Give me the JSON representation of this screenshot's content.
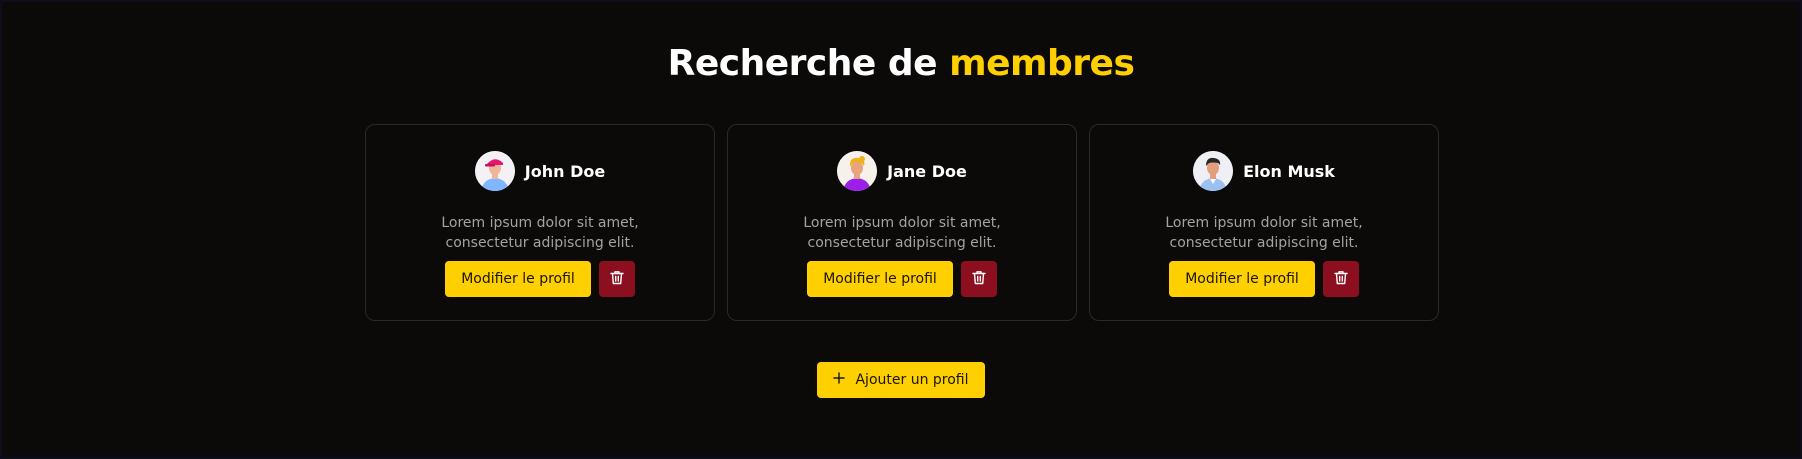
{
  "header": {
    "title_prefix": "Recherche de",
    "title_accent": "membres"
  },
  "colors": {
    "background": "#0b0a09",
    "accent": "#ffd000",
    "danger": "#8b0f1e",
    "card_border": "#2a2a2a",
    "muted_text": "#a3a3a3"
  },
  "members": [
    {
      "name": "John Doe",
      "description": "Lorem ipsum dolor sit amet, consectetur adipiscing elit.",
      "avatar_icon": "avatar-man-pink-cap-icon",
      "edit_label": "Modifier le profil",
      "delete_icon": "trash-icon"
    },
    {
      "name": "Jane Doe",
      "description": "Lorem ipsum dolor sit amet, consectetur adipiscing elit.",
      "avatar_icon": "avatar-woman-purple-icon",
      "edit_label": "Modifier le profil",
      "delete_icon": "trash-icon"
    },
    {
      "name": "Elon Musk",
      "description": "Lorem ipsum dolor sit amet, consectetur adipiscing elit.",
      "avatar_icon": "avatar-man-blue-shirt-icon",
      "edit_label": "Modifier le profil",
      "delete_icon": "trash-icon"
    }
  ],
  "add_button": {
    "label": "Ajouter un profil",
    "icon": "plus-icon"
  }
}
